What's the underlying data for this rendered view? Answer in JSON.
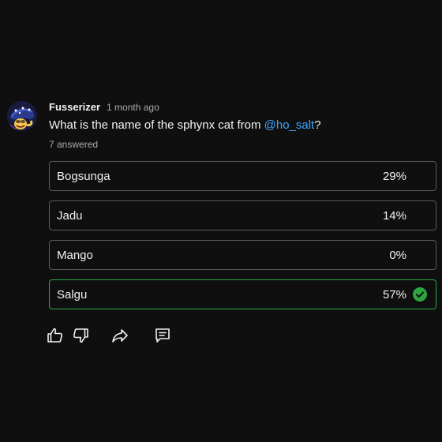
{
  "post": {
    "author": "Fusserizer",
    "timestamp": "1 month ago",
    "question_prefix": "What is the name of the sphynx cat from ",
    "mention": "@ho_salt",
    "question_suffix": "?",
    "answered": "7 answered"
  },
  "poll": {
    "options": [
      {
        "label": "Bogsunga",
        "percent": "29%",
        "correct": false
      },
      {
        "label": "Jadu",
        "percent": "14%",
        "correct": false
      },
      {
        "label": "Mango",
        "percent": "0%",
        "correct": false
      },
      {
        "label": "Salgu",
        "percent": "57%",
        "correct": true
      }
    ]
  },
  "actions": {
    "icons": [
      "thumbs-up-icon",
      "thumbs-down-icon",
      "share-icon",
      "comment-icon"
    ]
  },
  "colors": {
    "background": "#0f0f0f",
    "text": "#f1f1f1",
    "muted": "#aaaaaa",
    "mention": "#3ea6ff",
    "correct": "#2ba640",
    "border": "#5a5a5a"
  }
}
